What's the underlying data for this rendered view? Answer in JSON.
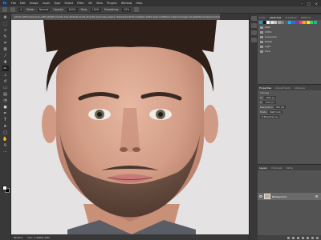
{
  "menubar": {
    "logo": "Ps",
    "items": [
      "File",
      "Edit",
      "Image",
      "Layer",
      "Type",
      "Select",
      "Filter",
      "3D",
      "View",
      "Plugins",
      "Window",
      "Help"
    ],
    "win_min": "–",
    "win_max": "□",
    "win_close": "×"
  },
  "options": {
    "tool_size": "4",
    "mode_label": "Mode:",
    "mode_value": "Normal",
    "opacity_label": "Opacity:",
    "opacity_value": "100%",
    "flow_label": "Flow:",
    "flow_value": "100%",
    "smoothing_label": "Smoothing:",
    "smoothing_value": "10%"
  },
  "document": {
    "tab_title": "photo-attractive-man-with-stylish-hairdo-has-stubble-looks-directly-seriously-wears-checkered-shirt-isolated-white-wall-confident-male-manager-at-website-background.jpg @ 66.7% (RGB/8#)"
  },
  "status": {
    "zoom": "66.67%",
    "doc_info": "Doc: 5.49M/5.49M"
  },
  "panels": {
    "top_tabs": [
      "Color",
      "Swatches",
      "Gradients",
      "Patterns"
    ],
    "swatch_colors": [
      "#00a0e9",
      "#1a1a1a",
      "#ffffff",
      "#e0e0e0",
      "#c0c0c0",
      "#a0a0a0",
      "#808080",
      "#606060",
      "#00b8ff",
      "#2f6fd6",
      "#8a2be2",
      "#ff3d6e",
      "#ffa500",
      "#ffe000",
      "#39d353",
      "#00c2b3"
    ],
    "folders": [
      "RGB",
      "CMYK",
      "Grayscale",
      "Pastel",
      "Light",
      "Pure"
    ],
    "props_tabs": [
      "Properties",
      "Adjustments",
      "Libraries"
    ],
    "props_section": "Canvas",
    "props_w_label": "W",
    "props_w_value": "2000 px",
    "props_h_label": "H",
    "props_h_value": "1333 px",
    "props_res_label": "Resolution",
    "props_res_value": "300 ppi",
    "props_mode_label": "Mode",
    "props_mode_value": "RGB Color",
    "props_bits_value": "8 Bits/Channel",
    "layers_tabs": [
      "Layers",
      "Channels",
      "Paths"
    ],
    "layer_name": "Background"
  }
}
